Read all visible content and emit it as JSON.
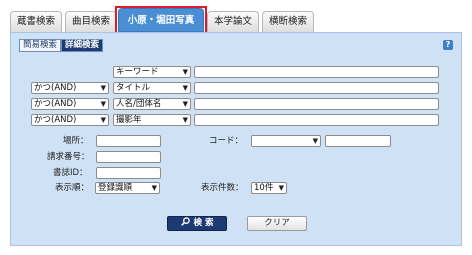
{
  "tabs": [
    {
      "label": "蔵書検索"
    },
    {
      "label": "曲目検索"
    },
    {
      "label": "小原・堀田写真"
    },
    {
      "label": "本学論文"
    },
    {
      "label": "横断検索"
    }
  ],
  "mode": {
    "simple": "簡易検索",
    "advanced": "詳細検索"
  },
  "help": "?",
  "rows": [
    {
      "operator": "",
      "field": "キーワード",
      "value": ""
    },
    {
      "operator": "かつ(AND)",
      "field": "タイトル",
      "value": ""
    },
    {
      "operator": "かつ(AND)",
      "field": "人名/団体名",
      "value": ""
    },
    {
      "operator": "かつ(AND)",
      "field": "撮影年",
      "value": ""
    }
  ],
  "labels": {
    "location": "場所：",
    "code": "コード：",
    "call_number": "請求番号：",
    "bib_id": "書誌ID：",
    "sort": "表示順：",
    "count": "表示件数："
  },
  "values": {
    "location": "",
    "code_select": "",
    "code_text": "",
    "call_number": "",
    "bib_id": "",
    "sort": "登録識順",
    "count": "10件"
  },
  "buttons": {
    "search": "検 索",
    "clear": "クリア"
  },
  "colors": {
    "active_tab": "#4a8fd4",
    "panel": "#cfe1f4",
    "primary_button": "#1d3a73",
    "highlight": "#e0192c"
  }
}
